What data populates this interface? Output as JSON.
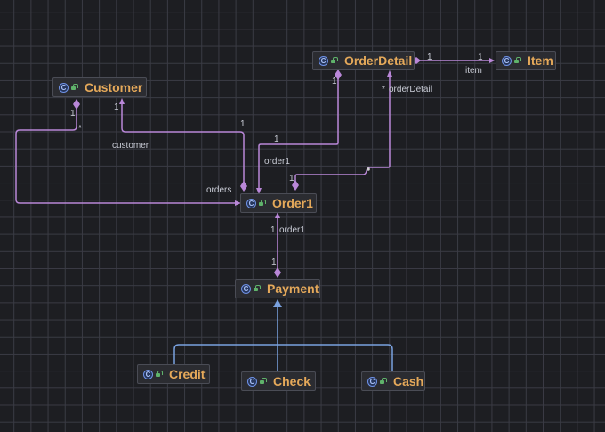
{
  "colors": {
    "background": "#1d1e22",
    "grid": "#3a3b44",
    "association": "#b987d8",
    "inheritance": "#7aa2e0",
    "class_title": "#e5a95a",
    "label": "#c9ccd6"
  },
  "nodes": {
    "customer": {
      "name": "Customer",
      "icon": "class-icon"
    },
    "order_detail": {
      "name": "OrderDetail",
      "icon": "class-icon"
    },
    "item": {
      "name": "Item",
      "icon": "class-icon"
    },
    "order1": {
      "name": "Order1",
      "icon": "class-icon"
    },
    "payment": {
      "name": "Payment",
      "icon": "class-icon"
    },
    "credit": {
      "name": "Credit",
      "icon": "class-icon"
    },
    "check": {
      "name": "Check",
      "icon": "class-icon"
    },
    "cash": {
      "name": "Cash",
      "icon": "class-icon"
    }
  },
  "labels": {
    "od_item_mult_source": "1",
    "od_item_mult_target": "1",
    "od_item_role": "item",
    "od_mult_bottom": "1",
    "od_detail_star": "*",
    "od_detail_role": "orderDetail",
    "customer_mult_left": "1",
    "customer_mult_right": "1",
    "customer_star": "*",
    "customer_role": "customer",
    "customer_link_mult": "1",
    "orders_role": "orders",
    "order1_mult_a": "1",
    "order1_role_a": "order1",
    "order1_mult_b": "1",
    "order1_pay_mult": "1",
    "order1_pay_role": "order1",
    "payment_mult": "1"
  },
  "class_glyph": "C"
}
